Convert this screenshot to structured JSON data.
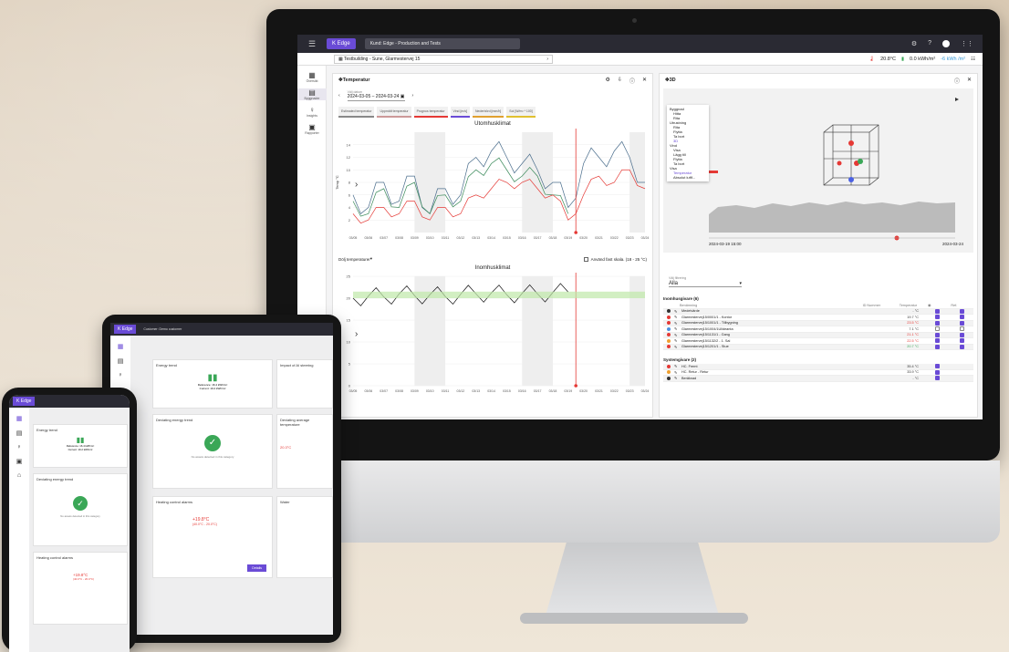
{
  "topbar": {
    "logo": "Edge",
    "customer": "Kund: Edge - Production and Tests"
  },
  "breadcrumb": "Testbuilding - Sune, Glarmestervej 15",
  "metrics": {
    "temp": "20.8°C",
    "energy": "0.0 kWh/m²",
    "delta": "-6 kWh /m²"
  },
  "nav": [
    {
      "label": "Översikt",
      "icon": "grid-icon"
    },
    {
      "label": "Byggnader",
      "icon": "building-icon"
    },
    {
      "label": "Insights",
      "icon": "bulb-icon"
    },
    {
      "label": "Rapporter",
      "icon": "report-icon"
    }
  ],
  "temp_panel": {
    "title": "Temperatur",
    "date_label": "Välj datum",
    "date_range": "2024-03-05 – 2024-03-24",
    "chips": [
      {
        "label": "Estimated temperatur",
        "color": "#888888"
      },
      {
        "label": "Uppmätt temperatur",
        "color": "#cc9999"
      },
      {
        "label": "Prognos temperatur",
        "color": "#e53935"
      },
      {
        "label": "Vind [m/s]",
        "color": "#6a4bd6"
      },
      {
        "label": "Nederbörd [mm/h]",
        "color": "#e0a030"
      },
      {
        "label": "Sol [W/m² * 100]",
        "color": "#e0c030"
      }
    ],
    "chart1_title": "Utomhusklimat",
    "ylabel1": "Temp °C",
    "hide_label": "Dölj temperaturer",
    "fixed_scale": "Använd fast skala. (18 - 25 °C)",
    "chart2_title": "Inomhusklimat"
  },
  "chart_data": [
    {
      "type": "line",
      "title": "Utomhusklimat",
      "ylabel": "Temp °C",
      "x": [
        "03/05",
        "03/06",
        "03/07",
        "03/08",
        "03/09",
        "03/10",
        "03/11",
        "03/12",
        "03/13",
        "03/14",
        "03/15",
        "03/16",
        "03/17",
        "03/18",
        "03/19",
        "03/20",
        "03/21",
        "03/22",
        "03/23",
        "03/24"
      ],
      "ylim": [
        0,
        16
      ],
      "series": [
        {
          "color": "#4a6d8c",
          "values": [
            6,
            4,
            8,
            5,
            9,
            3,
            7,
            6,
            12,
            13,
            12,
            11,
            10,
            8,
            4,
            11,
            12,
            13,
            12,
            8
          ]
        },
        {
          "color": "#3a8a5a",
          "values": [
            5,
            3,
            7,
            4,
            8,
            3,
            6,
            5,
            10,
            11,
            10,
            9,
            9,
            6,
            3,
            0,
            0,
            0,
            0,
            0
          ]
        },
        {
          "color": "#e53935",
          "values": [
            3,
            2,
            4,
            3,
            5,
            2,
            4,
            3,
            6,
            7,
            8,
            8,
            7,
            6,
            2,
            6,
            9,
            8,
            10,
            7
          ]
        }
      ]
    },
    {
      "type": "line",
      "title": "Inomhusklimat",
      "x": [
        "03/05",
        "03/06",
        "03/07",
        "03/08",
        "03/09",
        "03/10",
        "03/11",
        "03/12",
        "03/13",
        "03/14",
        "03/15",
        "03/16",
        "03/17",
        "03/18",
        "03/19",
        "03/20",
        "03/21",
        "03/22",
        "03/23",
        "03/24"
      ],
      "ylim": [
        0,
        25
      ],
      "series": [
        {
          "color": "#111111",
          "values": [
            20,
            20.5,
            20.3,
            21,
            20.6,
            20.8,
            20.4,
            20.9,
            21,
            21.2,
            20.8,
            21.1,
            21,
            21.3,
            21.4,
            0,
            0,
            0,
            0,
            0
          ]
        }
      ]
    }
  ],
  "panel3d": {
    "title": "3D",
    "tree": [
      "Byggnad",
      "Hitta",
      "Rita",
      "Utrustning",
      "Rita",
      "Flytta",
      "Ta bort",
      "3D",
      "Vind",
      "Visa",
      "Lägg till",
      "Flytta",
      "Ta bort",
      "Visa",
      "Temperatur",
      "Absolut luftf..."
    ],
    "mini_start": "2024-03-19 15:00",
    "mini_end": "2024-03-24",
    "filter_label": "Välj filtrering",
    "filter_value": "Alla",
    "indoor_header": "Inomhusgivare (6)",
    "cols": {
      "name": "Benämning",
      "id": "ID Nummer",
      "temp": "Temperatur",
      "ref": "Ref."
    },
    "indoor": [
      {
        "name": "Medelvärde",
        "temp": "- °C",
        "color": "#333333",
        "tcolor": "#333333",
        "on": true
      },
      {
        "name": "Glarmestervej15/0001/1 - Kontor",
        "temp": "19.7 °C",
        "color": "#e53935",
        "tcolor": "#333333",
        "on": true
      },
      {
        "name": "Glarmestervej15/1001/1 - Tillbygning",
        "temp": "23.5 °C",
        "color": "#e53935",
        "tcolor": "#e53935",
        "on": true
      },
      {
        "name": "Glarmestervej15/1004/1Ulldeanta",
        "temp": "7.1 °C",
        "color": "#4a90e2",
        "tcolor": "#333333",
        "on": false
      },
      {
        "name": "Glarmestervej15/1131/1 - Gang",
        "temp": "21.1 °C",
        "color": "#e53935",
        "tcolor": "#e53935",
        "on": true
      },
      {
        "name": "Glarmestervej15/1132/2 - 1. Sal",
        "temp": "22.5 °C",
        "color": "#f0a030",
        "tcolor": "#e53935",
        "on": true
      },
      {
        "name": "Glarmestervej15/1201/1 - Stue",
        "temp": "20.7 °C",
        "color": "#e53935",
        "tcolor": "#3aa757",
        "on": true
      }
    ],
    "system_header": "Systemgivare (2)",
    "system": [
      {
        "name": "HC. Fremt",
        "temp": "35.4 °C",
        "color": "#e53935"
      },
      {
        "name": "HC. Retur - Retur",
        "temp": "33.9 °C",
        "color": "#f0a030"
      },
      {
        "name": "Beräknad",
        "temp": "- °C",
        "color": "#333333"
      }
    ]
  },
  "tablet": {
    "logo": "Edge",
    "customer": "Customer: Demo customer",
    "cards": [
      {
        "title": "Energy trend",
        "line1": "Reference: 16.4 kWh/m²",
        "line2": "Current: 19.2 kWh/m²"
      },
      {
        "title": "Impact of AI steering"
      },
      {
        "title": "Deviating energy trend",
        "note": "No assets detected in this category"
      },
      {
        "title": "Deviating average temperature",
        "value": "20.3°C"
      },
      {
        "title": "Heating control alarms",
        "value": "+19.8°C",
        "sub": "(40.0°C - 20.0°C)",
        "btn": "Details"
      },
      {
        "title": "Water"
      }
    ]
  },
  "phone": {
    "logo": "Edge",
    "cards": [
      {
        "title": "Energy trend",
        "line1": "Reference: 16.4 kWh/m²",
        "line2": "Current: 19.2 kWh/m²"
      },
      {
        "title": "Deviating energy trend",
        "note": "No assets detected in this category"
      },
      {
        "title": "Heating control alarms",
        "value": "+19.8°C",
        "sub": "(40.0°C - 20.0°C)"
      }
    ]
  }
}
